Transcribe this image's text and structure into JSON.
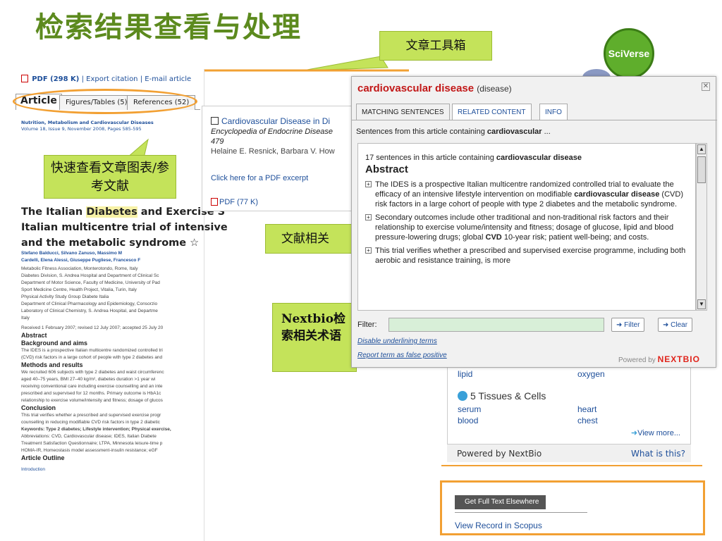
{
  "slide": {
    "title": "检索结果查看与处理",
    "callout_toolbox": "文章工具箱",
    "callout_quickview": "快速查看文章图表/参考文献",
    "callout_related": "文献相关",
    "callout_nextbio": "Nextbio检索相关术语",
    "logo_text": "SciVerse"
  },
  "article": {
    "toolbar": {
      "pdf_label": "PDF (298 K)",
      "export_label": "Export citation",
      "email_label": "E-mail article"
    },
    "tabs": [
      {
        "label": "Article"
      },
      {
        "label": "Figures/Tables (5)"
      },
      {
        "label": "References (52)"
      }
    ],
    "journal": "Nutrition, Metabolism and Cardiovascular Diseases",
    "volume": "Volume 18, Issue 9, November 2008, Pages 585-595",
    "title_line1_pre": "The Italian ",
    "title_keyword": "Diabetes",
    "title_line1_post": " and Exercise S",
    "title_line2": "Italian multicentre trial of intensive",
    "title_line3": "and the metabolic syndrome",
    "title_mark": "☆",
    "authors_line1": "Stefano Balducci, Silvano Zanuso, Massimo M",
    "authors_line2": "Cardelli, Elena Alessi, Giuseppe Pugliese, Francesco F",
    "affiliations": [
      "Metabolic Fitness Association, Monterotondo, Rome, Italy",
      "Diabetes Division, S. Andrea Hospital and Department of Clinical Sc",
      "Department of Motor Science, Faculty of Medicine, University of Pad",
      "Sport Medicine Centre, Health Project, Vitalia, Turin, Italy",
      "Physical Activity Study Group Diabete Italia",
      "Department of Clinical Pharmacology and Epidemiology, Consorzio",
      "Laboratory of Clinical Chemistry, S. Andrea Hospital, and Departme",
      "Italy"
    ],
    "received": "Received 1 February 2007; revised 12 July 2007; accepted 25 July 20",
    "abstract_head": "Abstract",
    "bg_head": "Background and aims",
    "bg_text1": "The IDES is a prospective Italian multicentre randomized controlled tri",
    "bg_text2": "(CVD) risk factors in a large cohort of people with type 2 diabetes and",
    "methods_head": "Methods and results",
    "methods_lines": [
      "We recruited 606 subjects with type 2 diabetes and waist circumferenc",
      "aged 40–75 years, BMI 27–40 kg/m², diabetes duration >1 year wi",
      "receiving conventional care including exercise counselling and an inte",
      "prescribed and supervised for 12 months. Primary outcome is HbA1c",
      "relationship to exercise volume/intensity and fitness; dosage of glucos"
    ],
    "conclusion_head": "Conclusion",
    "conclusion_lines": [
      "This trial verifies whether a prescribed and supervised exercise progr",
      "counselling in reducing modifiable CVD risk factors in type 2 diabetic"
    ],
    "keywords": "Keywords: Type 2 diabetes; Lifestyle intervention; Physical exercise,",
    "abbreviations": "Abbreviations: CVD, Cardiovascular disease; IDES, Italian Diabete",
    "abbr_line2": "Treatment Satisfaction Questionnaire; LTPA, Minnesota leisure-time p",
    "abbr_line3": "HOMA-IR, Homeostasis model assessment-insulin resistance; eGF",
    "outline_head": "Article Outline",
    "outline_item": "Introduction"
  },
  "midpanel": {
    "ref_title": "Cardiovascular Disease in Di",
    "ref_source": "Encyclopedia of Endocrine Disease",
    "ref_page": "479",
    "ref_authors": "Helaine E. Resnick, Barbara V. How",
    "excerpt_link": "Click here for a PDF excerpt",
    "pdf_label": "PDF (77 K)"
  },
  "popup": {
    "term": "cardiovascular disease",
    "term_type": "(disease)",
    "close_glyph": "✕",
    "tabs": [
      {
        "label": "MATCHING SENTENCES"
      },
      {
        "label": "RELATED CONTENT"
      },
      {
        "label": "INFO"
      }
    ],
    "heading_pre": "Sentences from this article containing ",
    "heading_term": "cardiovascular",
    "heading_post": " ...",
    "count_pre": "17 sentences in this article containing ",
    "count_term": "cardiovascular disease",
    "section": "Abstract",
    "expand_glyph": "+",
    "s1_a": "The IDES is a prospective Italian multicentre randomized controlled trial to evaluate the efficacy of an intensive lifestyle intervention on modifiable ",
    "s1_b": "cardiovascular disease",
    "s1_c": " (CVD) risk factors in a large cohort of people with type 2 diabetes and the metabolic syndrome.",
    "s2_a": "Secondary outcomes include other traditional and non-traditional risk factors and their relationship to exercise volume/intensity and fitness; dosage of glucose, lipid and blood pressure-lowering drugs; global ",
    "s2_b": "CVD",
    "s2_c": " 10-year risk; patient well-being; and costs.",
    "s3": "This trial verifies whether a prescribed and supervised exercise programme, including both aerobic and resistance training, is more",
    "filter_label": "Filter:",
    "filter_value": "",
    "filter_btn": "Filter",
    "clear_btn": "Clear",
    "btn_glyph": "➜",
    "disable_link": "Disable underlining terms",
    "report_link": "Report term as false positive",
    "powered_by": "Powered by",
    "brand": "NEXTBIO"
  },
  "nextbio_panel": {
    "row_left": "lipid",
    "row_right": "oxygen",
    "tissues_head": "5 Tissues & Cells",
    "tissue_items": [
      "serum",
      "heart",
      "blood",
      "chest"
    ],
    "view_more": "View more...",
    "powered": "Powered by NextBio",
    "what": "What is this?"
  },
  "scopus": {
    "get_full": "Get Full Text Elsewhere",
    "view_record": "View Record in Scopus"
  }
}
